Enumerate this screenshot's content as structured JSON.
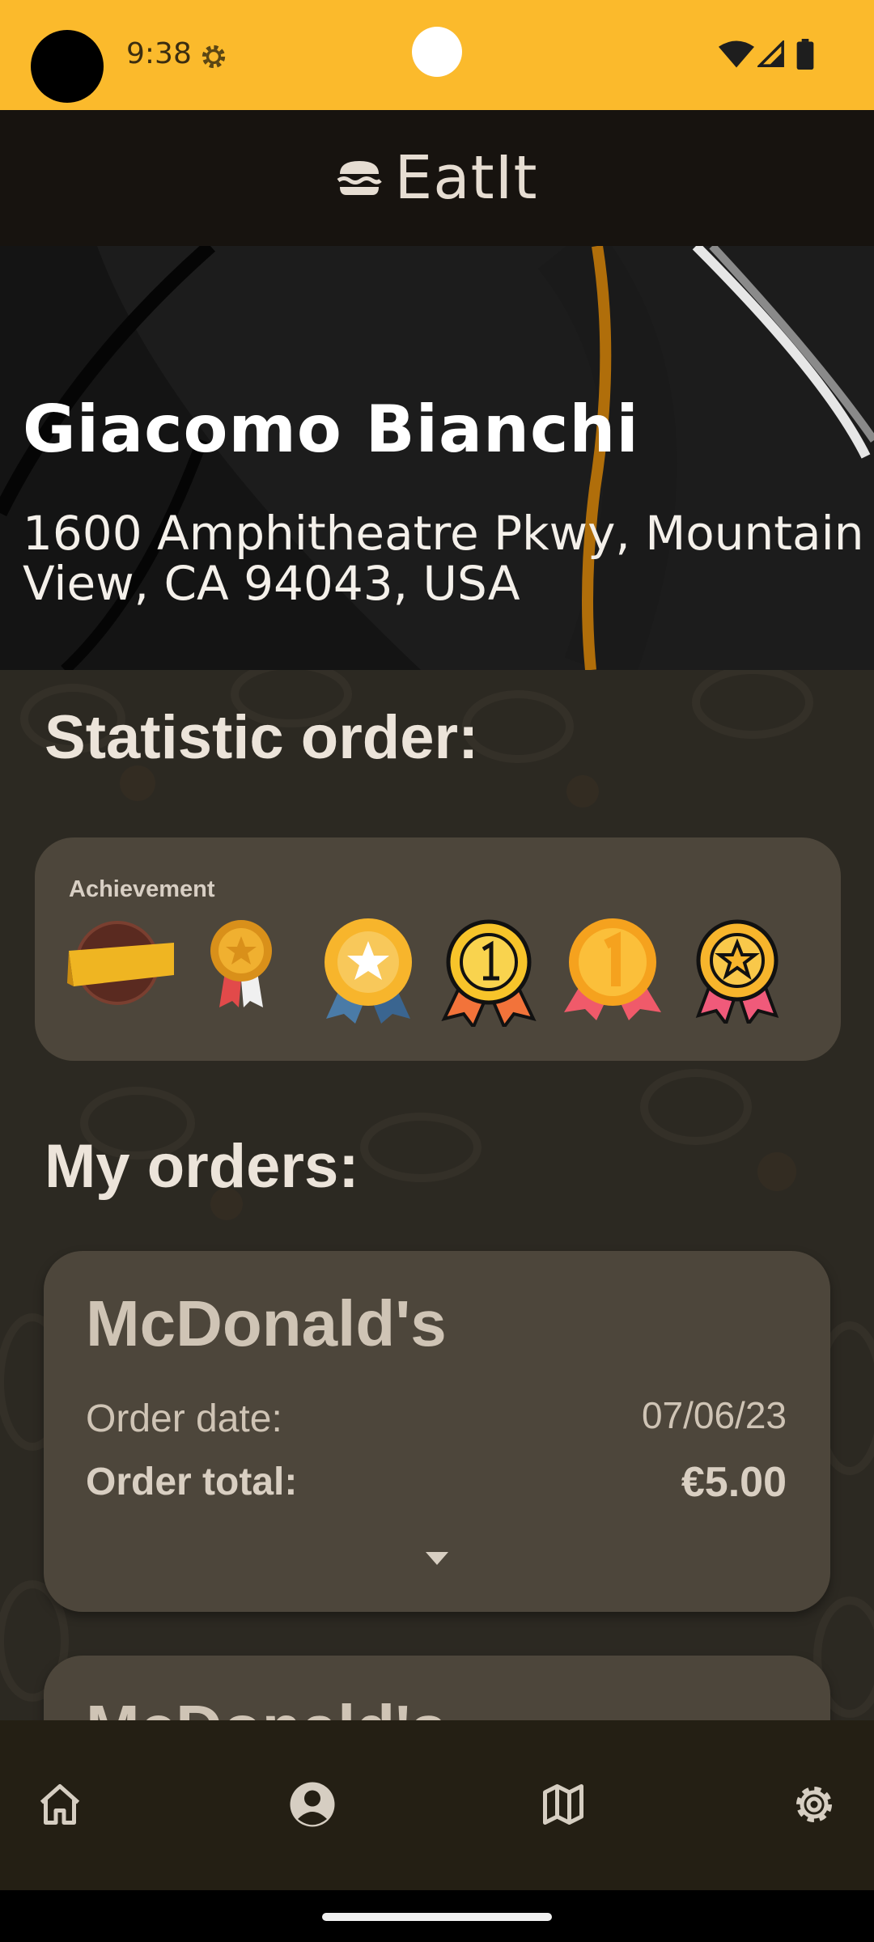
{
  "status_bar": {
    "time": "9:38",
    "icons": [
      "camera-hole",
      "gear-icon",
      "wifi-icon",
      "signal-icon",
      "battery-icon"
    ],
    "background_color": "#fbba2c"
  },
  "app_bar": {
    "title": "EatIt",
    "logo_icon": "burger-icon"
  },
  "profile": {
    "name": "Giacomo Bianchi",
    "address": "1600 Amphitheatre Pkwy, Mountain View, CA 94043, USA"
  },
  "statistics": {
    "title": "Statistic order:",
    "achievement_label": "Achievement",
    "medals": [
      "banner-badge-icon",
      "rosette-medal-icon",
      "star-medal-icon",
      "first-place-medal-icon",
      "gold-first-medal-icon",
      "star-ribbon-medal-icon"
    ]
  },
  "orders": {
    "title": "My orders:",
    "date_label": "Order date:",
    "total_label": "Order total:",
    "items": [
      {
        "restaurant": "McDonald's",
        "date": "07/06/23",
        "total": "€5.00"
      },
      {
        "restaurant": "McDonald's"
      }
    ]
  },
  "bottom_nav": {
    "items": [
      "home-icon",
      "profile-icon",
      "map-icon",
      "settings-icon"
    ],
    "active": "profile-icon"
  },
  "colors": {
    "accent": "#fbba2c",
    "app_bar": "#17130f",
    "card": "#4d463b",
    "nav": "#241f14"
  }
}
